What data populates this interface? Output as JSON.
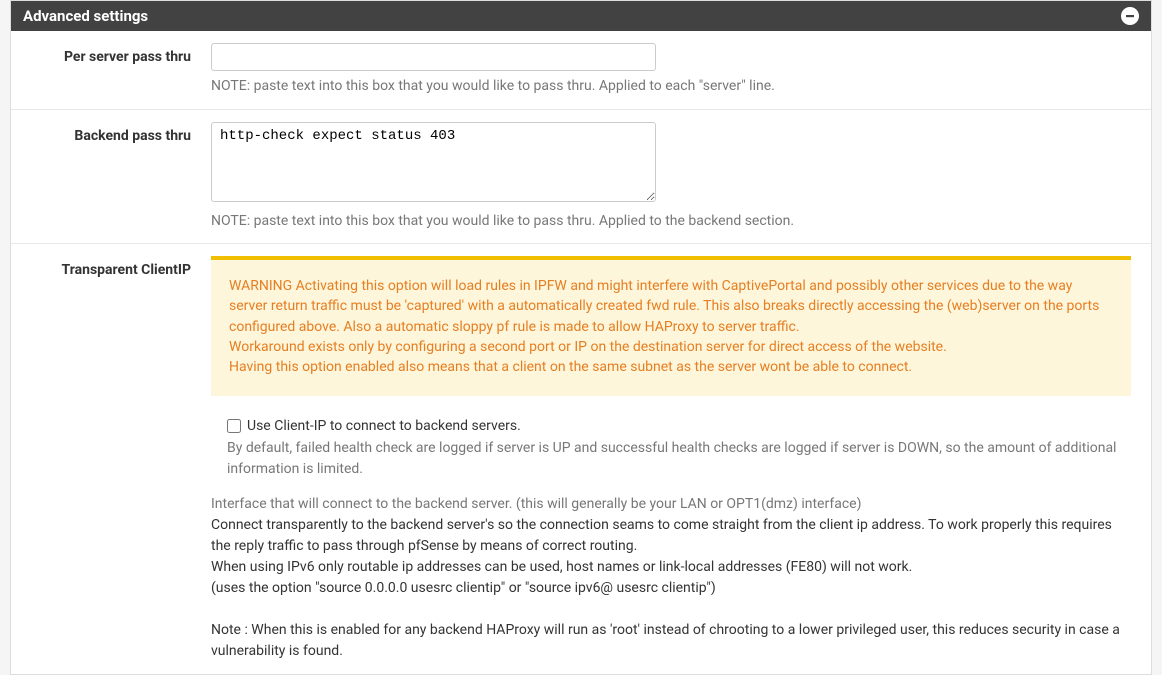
{
  "panel": {
    "title": "Advanced settings"
  },
  "per_server": {
    "label": "Per server pass thru",
    "value": "",
    "note": "NOTE: paste text into this box that you would like to pass thru. Applied to each \"server\" line."
  },
  "backend": {
    "label": "Backend pass thru",
    "value": "http-check expect status 403",
    "note": "NOTE: paste text into this box that you would like to pass thru. Applied to the backend section."
  },
  "transparent": {
    "label": "Transparent ClientIP",
    "warning_l1": "WARNING Activating this option will load rules in IPFW and might interfere with CaptivePortal and possibly other services due to the way server return traffic must be 'captured' with a automatically created fwd rule. This also breaks directly accessing the (web)server on the ports configured above. Also a automatic sloppy pf rule is made to allow HAProxy to server traffic.",
    "warning_l2": "Workaround exists only by configuring a second port or IP on the destination server for direct access of the website.",
    "warning_l3": "Having this option enabled also means that a client on the same subnet as the server wont be able to connect.",
    "checkbox_label": "Use Client-IP to connect to backend servers.",
    "checkbox_help": "By default, failed health check are logged if server is UP and successful health checks are logged if server is DOWN, so the amount of additional information is limited.",
    "desc_muted": "Interface that will connect to the backend server. (this will generally be your LAN or OPT1(dmz) interface)",
    "desc_p1": "Connect transparently to the backend server's so the connection seams to come straight from the client ip address. To work properly this requires the reply traffic to pass through pfSense by means of correct routing.",
    "desc_p2": "When using IPv6 only routable ip addresses can be used, host names or link-local addresses (FE80) will not work.",
    "desc_p3": "(uses the option \"source 0.0.0.0 usesrc clientip\" or \"source ipv6@ usesrc clientip\")",
    "desc_note": "Note : When this is enabled for any backend HAProxy will run as 'root' instead of chrooting to a lower privileged user, this reduces security in case a vulnerability is found."
  }
}
